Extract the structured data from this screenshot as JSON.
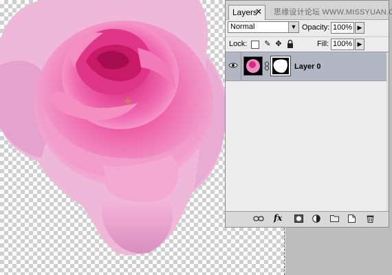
{
  "panel": {
    "tab_label": "Layers",
    "tab_close": "✕",
    "watermark": "思缘设计论坛  WWW.MISSYUAN.COM"
  },
  "blend": {
    "mode": "Normal",
    "opacity_label": "Opacity:",
    "opacity_value": "100%"
  },
  "lock": {
    "label": "Lock:",
    "fill_label": "Fill:",
    "fill_value": "100%"
  },
  "layers": [
    {
      "name": "Layer 0",
      "visible": true,
      "has_mask": true
    }
  ],
  "icons": {
    "eye": "eye-icon",
    "chain": "link-icon",
    "lock_transparent": "lock-transparent-icon",
    "lock_paint": "brush-icon",
    "lock_move": "move-icon",
    "lock_all": "lock-icon",
    "bottom": [
      "link-layers-icon",
      "fx-icon",
      "add-mask-icon",
      "adjustment-icon",
      "group-folder-icon",
      "new-layer-icon",
      "trash-icon"
    ]
  },
  "bottom_bar": {
    "fx_text": "fx"
  },
  "colors": {
    "selected_row": "#b3b7c4",
    "panel_bg": "#ececec",
    "rose_pink": "#f06bb0"
  }
}
